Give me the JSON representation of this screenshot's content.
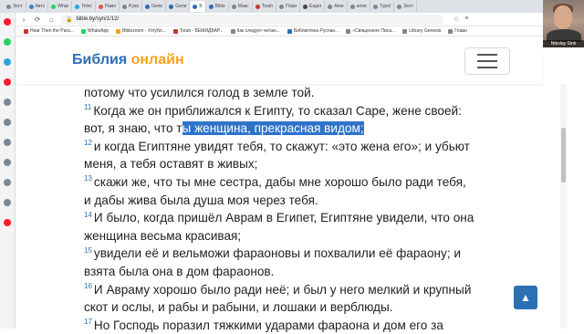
{
  "browser": {
    "tabs": [
      {
        "label": "Зеcт",
        "color": "#7b8793",
        "active": false
      },
      {
        "label": "Автс",
        "color": "#3b7fd0",
        "active": false
      },
      {
        "label": "Whar",
        "color": "#25d366",
        "active": false
      },
      {
        "label": "Telec",
        "color": "#2aa3df",
        "active": false
      },
      {
        "label": "Рамо",
        "color": "#e2574c",
        "active": false
      },
      {
        "label": "Рука",
        "color": "#7b8793",
        "active": false
      },
      {
        "label": "Gene",
        "color": "#2c6fb3",
        "active": false
      },
      {
        "label": "Gene",
        "color": "#2c6fb3",
        "active": false
      },
      {
        "label": "Б",
        "color": "#2c6fb3",
        "active": true
      },
      {
        "label": "Bible",
        "color": "#2c6fb3",
        "active": false
      },
      {
        "label": "Макс",
        "color": "#7b8793",
        "active": false
      },
      {
        "label": "Torah",
        "color": "#c0392b",
        "active": false
      },
      {
        "label": "Пори",
        "color": "#7b8793",
        "active": false
      },
      {
        "label": "Eager",
        "color": "#444444",
        "active": false
      },
      {
        "label": "Ame",
        "color": "#7b8793",
        "active": false
      },
      {
        "label": "amer",
        "color": "#7b8793",
        "active": false
      },
      {
        "label": "Typol",
        "color": "#7b8793",
        "active": false
      },
      {
        "label": "Зеcт",
        "color": "#7b8793",
        "active": false
      }
    ],
    "window_controls": [
      "–",
      "□",
      "✕"
    ],
    "address": "bible.by/syn/1/12/",
    "nav": {
      "back": "‹",
      "forward": "›",
      "reload": "⟳",
      "home": "⌂"
    },
    "bookmarks": [
      {
        "label": "Hear Then the Para...",
        "color": "#c0392b"
      },
      {
        "label": "WhatsApp",
        "color": "#25d366"
      },
      {
        "label": "Biblezoom - Углубл...",
        "color": "#f5a31a"
      },
      {
        "label": "Torah - БЕМИДБАР...",
        "color": "#c0392b"
      },
      {
        "label": "Как следует читаю...",
        "color": "#7b8793"
      },
      {
        "label": "Библиотека Руслан...",
        "color": "#2c6fb3"
      },
      {
        "label": "«Священное Писа...",
        "color": "#7b8793"
      },
      {
        "label": "Library Genesis",
        "color": "#7b8793"
      },
      {
        "label": "Главн",
        "color": "#7b8793"
      }
    ]
  },
  "site": {
    "logo_main": "Библия",
    "logo_accent": "онлайн",
    "brand_color": "#2c6fb3",
    "accent_color": "#f5a31a"
  },
  "passage": {
    "lines": [
      {
        "num": "",
        "text": "потому что усилился голод в земле той."
      },
      {
        "num": "11",
        "text": "Когда же он приближался к Египту, то сказал Саре, жене своей:"
      },
      {
        "num": "",
        "pre": "вот, я знаю, что т",
        "highlight": "ы женщина, прекрасная видом;"
      },
      {
        "num": "12",
        "text": "и когда Египтяне увидят тебя, то скажут: «это жена его»; и убьют"
      },
      {
        "num": "",
        "text": "меня, а тебя оставят в живых;"
      },
      {
        "num": "13",
        "text": "скажи же, что ты мне сестра, дабы мне хорошо было ради тебя,"
      },
      {
        "num": "",
        "text": "и дабы жива была душа моя через тебя."
      },
      {
        "num": "14",
        "text": "И было, когда пришёл Аврам в Египет, Египтяне увидели, что она"
      },
      {
        "num": "",
        "text": "женщина весьма красивая;"
      },
      {
        "num": "15",
        "text": "увидели её и вельможи фараоновы и похвалили её фараону; и"
      },
      {
        "num": "",
        "text": "взята была она в дом фараонов."
      },
      {
        "num": "16",
        "text": "И Авраму хорошо было ради неё; и был у него мелкий и крупный"
      },
      {
        "num": "",
        "text": "скот и ослы, и рабы и рабыни, и лошаки и верблюды."
      },
      {
        "num": "17",
        "text": "Но Господь поразил тяжкими ударами фараона и дом его за"
      }
    ]
  },
  "webcam": {
    "name": "Nikolay Sink"
  },
  "to_top_icon": "▲",
  "opera_sidebar_colors": [
    "#ff1b2d",
    "#25d366",
    "#2aa3df",
    "#ff1b2d",
    "#7b8793",
    "#7b8793",
    "#7b8793",
    "#7b8793",
    "#7b8793",
    "#7b8793",
    "#ff1b2d"
  ]
}
